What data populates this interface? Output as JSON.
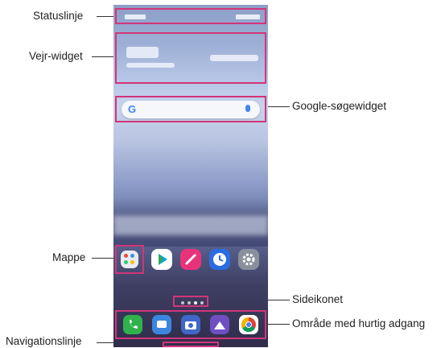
{
  "labels": {
    "statusbar": "Statuslinje",
    "weather": "Vejr-widget",
    "google_search": "Google-søgewidget",
    "folder": "Mappe",
    "page_icon": "Sideikonet",
    "quick_access": "Område med hurtig adgang",
    "navigation": "Navigationslinje"
  },
  "screen": {
    "search_logo": "G",
    "quick_apps": [
      "phone-icon",
      "messages-icon",
      "camera-icon",
      "gallery-icon",
      "chrome-icon"
    ],
    "home_apps": [
      "folder-icon",
      "play-store-icon",
      "pen-icon",
      "clock-icon",
      "settings-icon"
    ],
    "colors": {
      "highlight": "#d2357a",
      "phone_app": "#2fb24b",
      "messages_app": "#3d86e0",
      "camera_app": "#3f67c8",
      "gallery_app": "#6e4fc2",
      "pen_app": "#e8337a",
      "clock_app": "#2b6ce0",
      "settings_app": "#8a8f9e"
    }
  }
}
